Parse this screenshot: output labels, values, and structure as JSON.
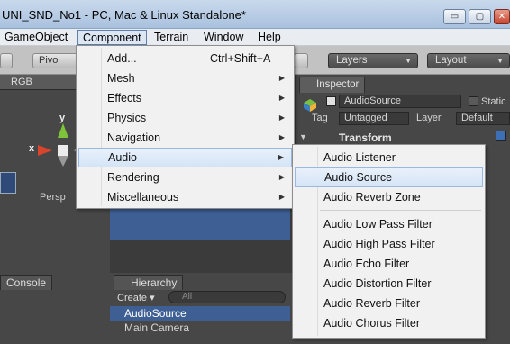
{
  "window": {
    "title": "UNI_SND_No1 - PC, Mac & Linux Standalone*",
    "min_icon": "▭",
    "max_icon": "▢",
    "close_icon": "✕"
  },
  "menubar": {
    "items": [
      "GameObject",
      "Component",
      "Terrain",
      "Window",
      "Help"
    ]
  },
  "toolbar": {
    "pivot": "Pivo",
    "layers": "Layers",
    "layout": "Layout"
  },
  "scene": {
    "mode": "RGB",
    "axis_y": "y",
    "axis_x": "x",
    "persp": "Persp"
  },
  "inspector": {
    "tab": "Inspector",
    "object_name": "AudioSource",
    "static_label": "Static",
    "tag_label": "Tag",
    "tag_value": "Untagged",
    "layer_label": "Layer",
    "layer_value": "Default",
    "component": "Transform"
  },
  "component_menu": {
    "items": [
      {
        "label": "Add...",
        "shortcut": "Ctrl+Shift+A"
      },
      {
        "label": "Mesh"
      },
      {
        "label": "Effects"
      },
      {
        "label": "Physics"
      },
      {
        "label": "Navigation"
      },
      {
        "label": "Audio"
      },
      {
        "label": "Rendering"
      },
      {
        "label": "Miscellaneous"
      }
    ]
  },
  "audio_menu": {
    "items": [
      "Audio Listener",
      "Audio Source",
      "Audio Reverb Zone",
      "Audio Low Pass Filter",
      "Audio High Pass Filter",
      "Audio Echo Filter",
      "Audio Distortion Filter",
      "Audio Reverb Filter",
      "Audio Chorus Filter"
    ]
  },
  "bottom": {
    "console_tab": "Console",
    "hierarchy_tab": "Hierarchy",
    "create": "Create",
    "search_placeholder": "All",
    "rows": [
      "AudioSource",
      "Main Camera"
    ]
  },
  "colors": {
    "selection": "#3d5f94",
    "menu_bg": "#f1f1f1",
    "highlight": "#d5e4f6"
  }
}
